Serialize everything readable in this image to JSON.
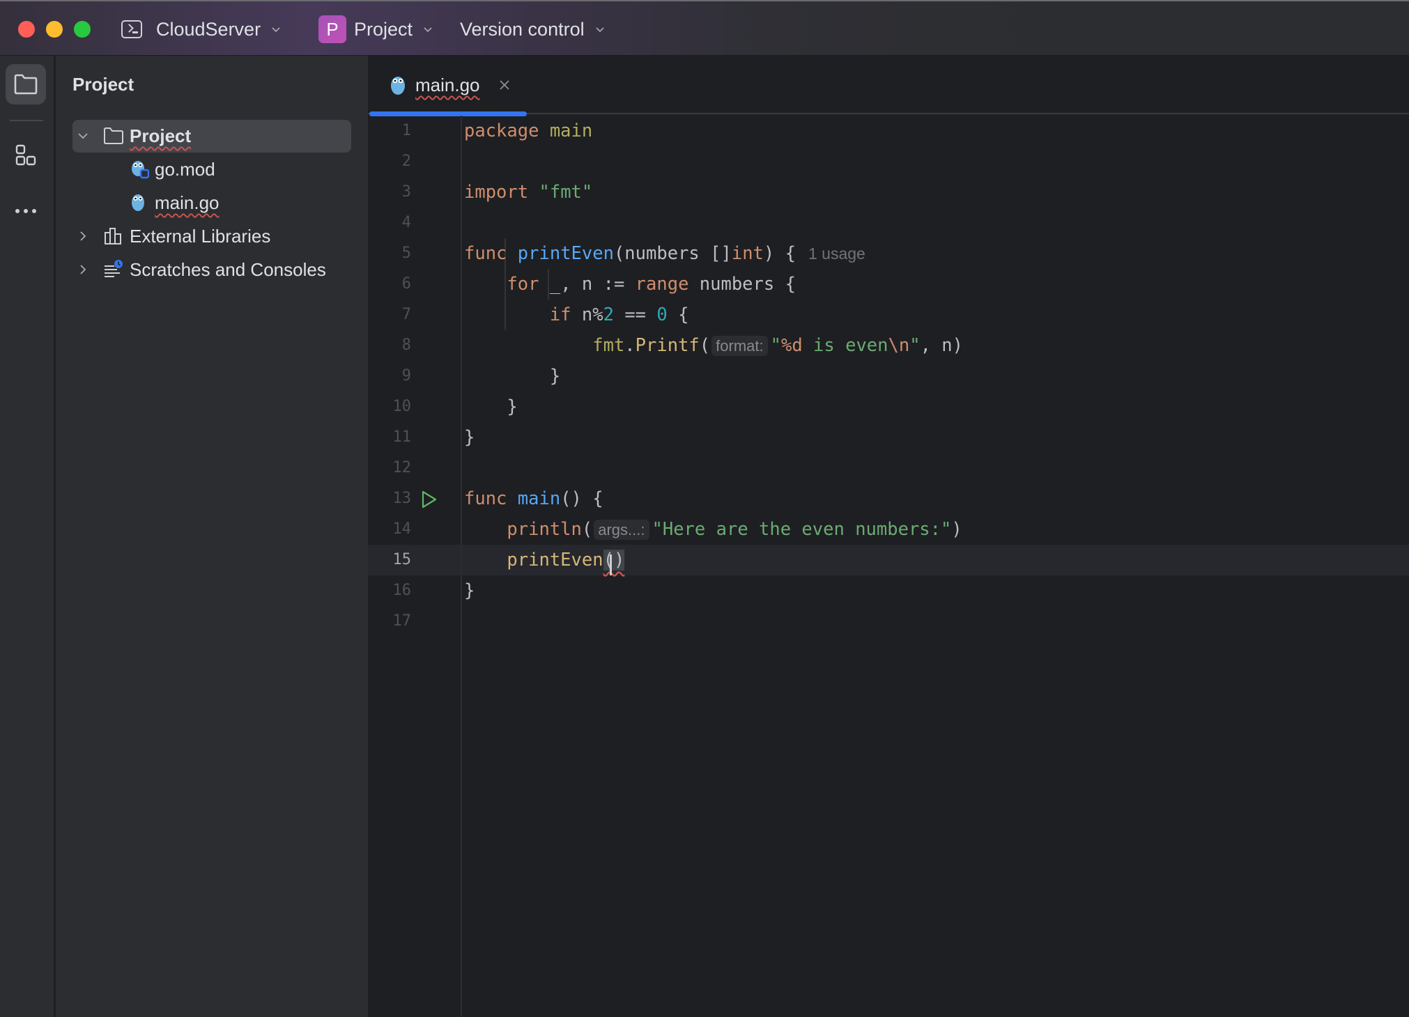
{
  "window": {
    "project_widget": {
      "label": "CloudServer",
      "icon": "terminal-icon"
    },
    "project_selector": {
      "badge": "P",
      "label": "Project"
    },
    "vcs_selector": {
      "label": "Version control"
    },
    "accent_color": "#3574f0",
    "badge_color": "#b04fc0"
  },
  "toolstrip": {
    "items": [
      {
        "name": "project-tool",
        "icon": "folder-icon",
        "active": true
      },
      {
        "name": "structure-tool",
        "icon": "structure-icon",
        "active": false
      },
      {
        "name": "more-tools",
        "icon": "more-icon",
        "active": false
      }
    ]
  },
  "sidebar": {
    "title": "Project",
    "tree": [
      {
        "label": "Project",
        "type": "folder",
        "expanded": true,
        "selected": true,
        "depth": 0
      },
      {
        "label": "go.mod",
        "type": "gomod-file",
        "depth": 1
      },
      {
        "label": "main.go",
        "type": "go-file",
        "depth": 1
      },
      {
        "label": "External Libraries",
        "type": "libraries",
        "expanded": false,
        "depth": 0
      },
      {
        "label": "Scratches and Consoles",
        "type": "scratches",
        "expanded": false,
        "depth": 0
      }
    ]
  },
  "editor": {
    "tabs": [
      {
        "label": "main.go",
        "active": true,
        "close": "×"
      }
    ],
    "current_line": 15,
    "lines": [
      {
        "n": "1"
      },
      {
        "n": "2"
      },
      {
        "n": "3"
      },
      {
        "n": "4"
      },
      {
        "n": "5"
      },
      {
        "n": "6"
      },
      {
        "n": "7"
      },
      {
        "n": "8"
      },
      {
        "n": "9"
      },
      {
        "n": "10"
      },
      {
        "n": "11"
      },
      {
        "n": "12"
      },
      {
        "n": "13"
      },
      {
        "n": "14"
      },
      {
        "n": "15"
      },
      {
        "n": "16"
      },
      {
        "n": "17"
      }
    ],
    "code": {
      "l1": {
        "kw": "package",
        "name": "main"
      },
      "l3": {
        "kw": "import",
        "str": "\"fmt\""
      },
      "l5": {
        "kw": "func",
        "fn": "printEven",
        "open": "(numbers []",
        "type": "int",
        "close": ") {",
        "usage": "1 usage"
      },
      "l6": {
        "kw1": "for",
        "mid": " _, n := ",
        "kw2": "range",
        "tail": " numbers {"
      },
      "l7": {
        "kw": "if",
        "mid": " n%",
        "num1": "2",
        "op": " == ",
        "num2": "0",
        "tail": " {"
      },
      "l8": {
        "pkg": "fmt",
        "dot": ".",
        "fn": "Printf",
        "open": "(",
        "hint": "format:",
        "q1": "\"",
        "esc1": "%d",
        "s": " is even",
        "esc2": "\\n",
        "q2": "\"",
        "tail": ", n)"
      },
      "l9": {
        "text": "}"
      },
      "l10": {
        "text": "}"
      },
      "l11": {
        "text": "}"
      },
      "l13": {
        "kw": "func",
        "fn": "main",
        "tail": "() {"
      },
      "l14": {
        "fn": "println",
        "open": "(",
        "hint": "args...:",
        "str": "\"Here are the even numbers:\"",
        "close": ")"
      },
      "l15": {
        "fn": "printEven",
        "paren": "()"
      },
      "l16": {
        "text": "}"
      }
    },
    "syntax_colors": {
      "keyword": "#cf8e6d",
      "string": "#6aab73",
      "number": "#2aacb8",
      "function_declaration": "#56a8f5",
      "function_call": "#d5b778",
      "package": "#b3ae60"
    }
  }
}
